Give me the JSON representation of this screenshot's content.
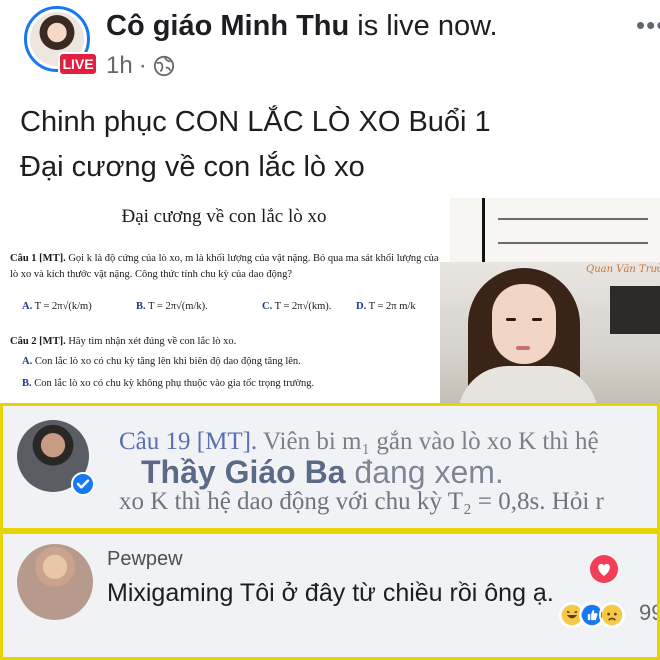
{
  "header": {
    "author_name": "Cô giáo Minh Thu",
    "status_text": "is live now.",
    "live_badge": "LIVE",
    "time": "1h",
    "separator": "·",
    "privacy_icon": "globe-icon",
    "more_icon": "more-options-icon"
  },
  "post": {
    "line1": "Chinh phục CON LẮC LÒ XO Buổi 1",
    "line2": "Đại cương về con lắc lò xo"
  },
  "video": {
    "doc_title": "Đại cương về con lắc lò xo",
    "q1_label": "Câu 1 [MT].",
    "q1_text_1": "Gọi k là độ cứng của lò xo, m là khối lượng của vật nặng. Bỏ qua ma sát khối lượng của",
    "q1_text_2": "lò xo và kích thước vật nặng. Công thức tính chu kỳ của dao động?",
    "q1_options": [
      {
        "letter": "A.",
        "formula": "T = 2π√(k/m)"
      },
      {
        "letter": "B.",
        "formula": "T = 2π√(m/k)."
      },
      {
        "letter": "C.",
        "formula": "T = 2π√(km)."
      },
      {
        "letter": "D.",
        "formula": "T = 2π m/k"
      }
    ],
    "q2_label": "Câu 2 [MT].",
    "q2_text": "Hãy tìm nhận xét đúng về con lắc lò xo.",
    "q2_options": [
      {
        "letter": "A.",
        "text": "Con lắc lò xo có chu kỳ tăng lên khi biên độ dao động tăng lên."
      },
      {
        "letter": "B.",
        "text": "Con lắc lò xo có chu kỳ không phụ thuộc vào gia tốc trọng trường."
      }
    ],
    "webcam_watermark": "Quan Văn Trường"
  },
  "comment1": {
    "bg_line1_q": "Câu 19 [MT].",
    "bg_line1_rest": "Viên bi m₁ gắn vào lò xo K thì hệ",
    "bg_line2": "xo K thì hệ dao động với chu kỳ T₂ = 0,8s. Hỏi r",
    "overlay_name": "Thầy Giáo Ba",
    "overlay_action": "đang xem.",
    "verified_icon": "verified-check-icon"
  },
  "comment2": {
    "name": "Pewpew",
    "text": "Mixigaming Tôi ở đây từ chiều rồi ông ạ.",
    "reaction_count": "99",
    "reactions": [
      "haha-icon",
      "like-icon",
      "sad-icon"
    ],
    "heart_icon": "love-reaction-icon"
  },
  "colors": {
    "facebook_blue": "#1877f2",
    "live_red": "#e41e3f",
    "highlight_border": "#e6d500",
    "comment_bg": "#f0f2f5"
  }
}
